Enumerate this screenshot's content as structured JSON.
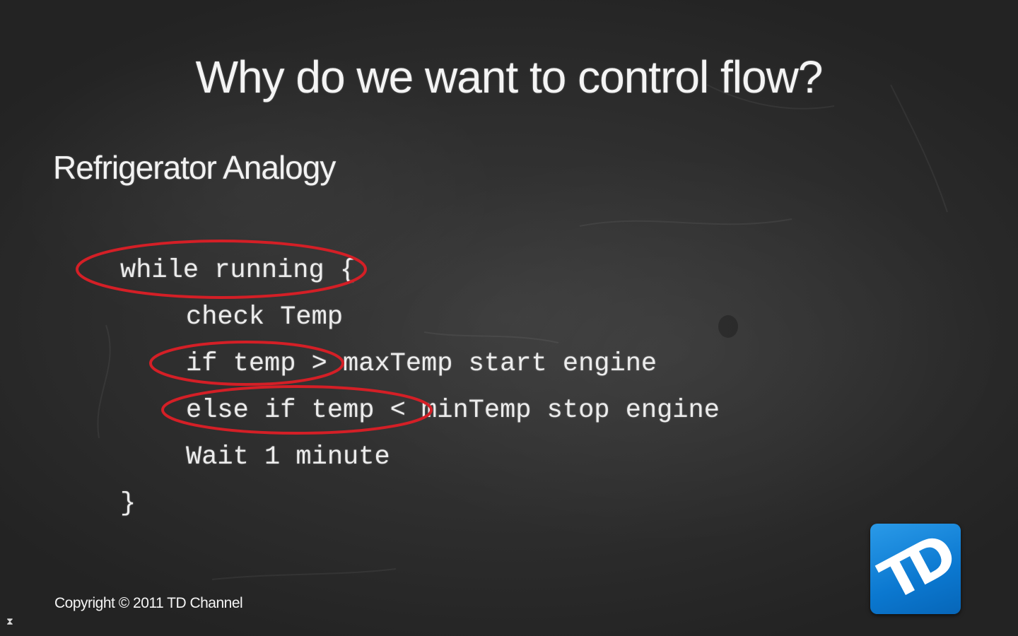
{
  "slide": {
    "title": "Why do we want to control flow?",
    "subtitle": "Refrigerator Analogy",
    "code_lines": [
      "while running {",
      "check Temp",
      "if temp > maxTemp start engine",
      "else if temp < minTemp stop engine",
      "Wait 1 minute",
      "}"
    ],
    "footer": "Copyright © 2011 TD Channel",
    "logo_text": "TD"
  },
  "icons": {
    "corner": "hourglass-icon",
    "corner_glyph": "⧗"
  },
  "colors": {
    "background": "#2e2e2e",
    "text": "#f2f2f2",
    "highlight": "#d41f26",
    "logo": "#0b78d0"
  }
}
